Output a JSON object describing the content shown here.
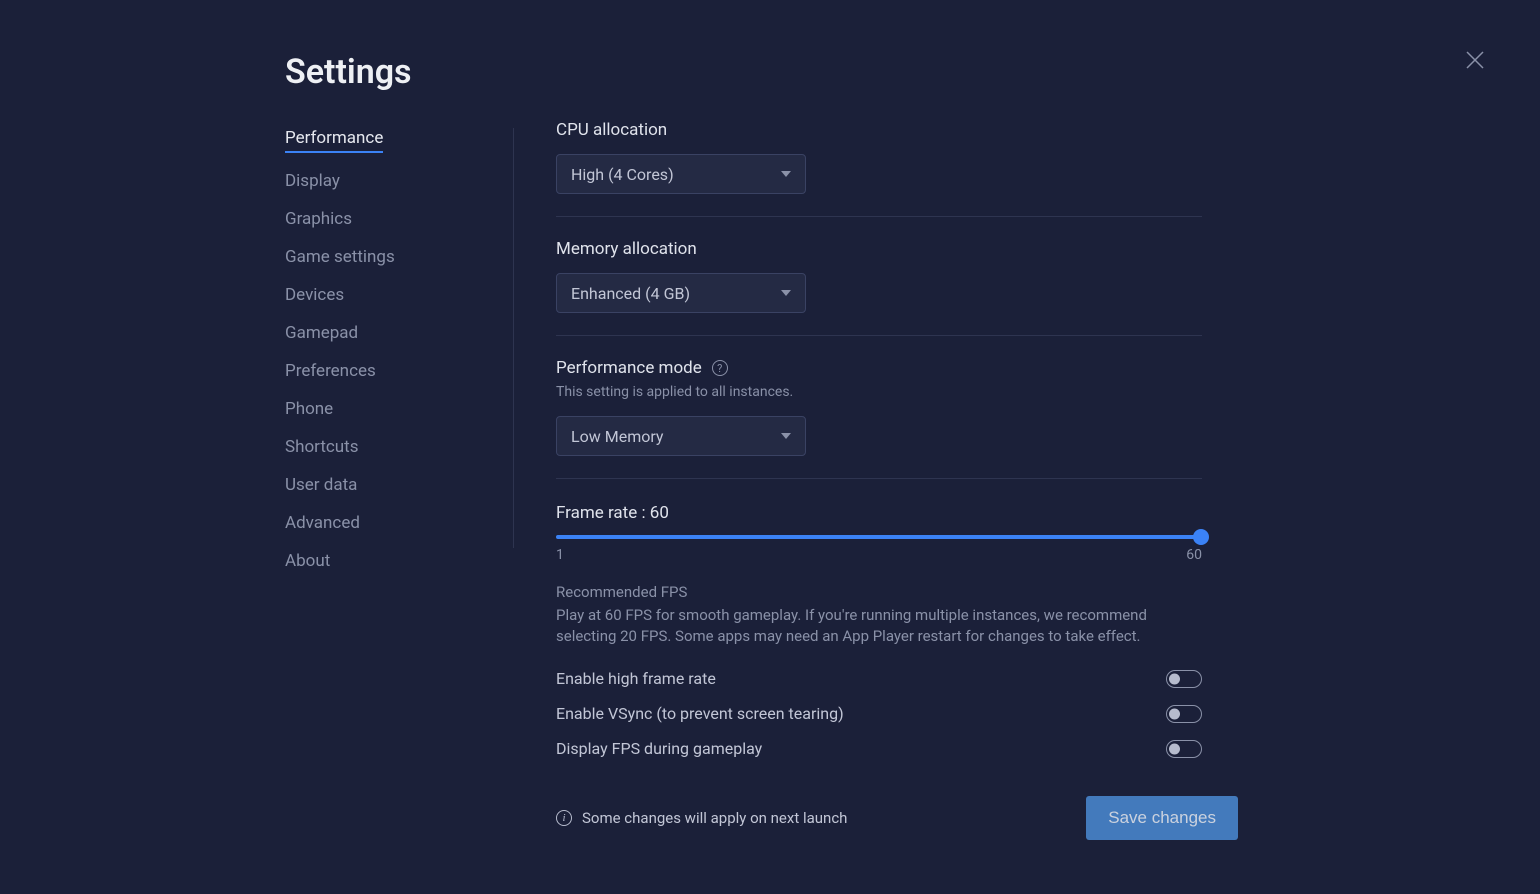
{
  "title": "Settings",
  "sidebar": {
    "items": [
      {
        "label": "Performance",
        "active": true
      },
      {
        "label": "Display"
      },
      {
        "label": "Graphics"
      },
      {
        "label": "Game settings"
      },
      {
        "label": "Devices"
      },
      {
        "label": "Gamepad"
      },
      {
        "label": "Preferences"
      },
      {
        "label": "Phone"
      },
      {
        "label": "Shortcuts"
      },
      {
        "label": "User data"
      },
      {
        "label": "Advanced"
      },
      {
        "label": "About"
      }
    ]
  },
  "sections": {
    "cpu": {
      "label": "CPU allocation",
      "value": "High (4 Cores)"
    },
    "memory": {
      "label": "Memory allocation",
      "value": "Enhanced (4 GB)"
    },
    "perfmode": {
      "label": "Performance mode",
      "hint": "This setting is applied to all instances.",
      "value": "Low Memory"
    },
    "framerate": {
      "label": "Frame rate : 60",
      "min": "1",
      "max": "60",
      "recommended_title": "Recommended FPS",
      "recommended_text": "Play at 60 FPS for smooth gameplay. If you're running multiple instances, we recommend selecting 20 FPS. Some apps may need an App Player restart for changes to take effect."
    }
  },
  "toggles": {
    "highfps": "Enable high frame rate",
    "vsync": "Enable VSync (to prevent screen tearing)",
    "displayfps": "Display FPS during gameplay"
  },
  "footer": {
    "note": "Some changes will apply on next launch",
    "save": "Save changes"
  }
}
